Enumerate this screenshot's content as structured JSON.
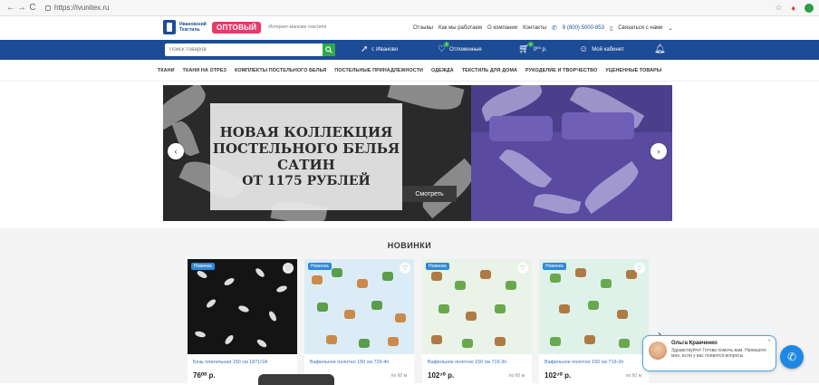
{
  "browser": {
    "url": "https://ivunitex.ru",
    "back": "←",
    "forward": "→",
    "reload": "C"
  },
  "header": {
    "logo_text": "Ивановский Текстиль",
    "badge": "ОПТОВЫЙ",
    "tagline": "Интернет-магазин текстиля",
    "nav": [
      "Отзывы",
      "Как мы работаем",
      "О компании",
      "Контакты"
    ],
    "phone": "8 (800) 5000-853",
    "contact_label": "Связаться с нами",
    "contact_chevron": "⌄"
  },
  "bluebar": {
    "search_placeholder": "Поиск товаров",
    "city": "г. Иваново",
    "deferred": "Отложенные",
    "deferred_count": "0",
    "cart_count": "0",
    "cart_price": "0⁰⁰ р.",
    "account": "Мой кабинет"
  },
  "categories": [
    "ТКАНИ",
    "ТКАНИ НА ОТРЕЗ",
    "КОМПЛЕКТЫ ПОСТЕЛЬНОГО БЕЛЬЯ",
    "ПОСТЕЛЬНЫЕ ПРИНАДЛЕЖНОСТИ",
    "ОДЕЖДА",
    "ТЕКСТИЛЬ ДЛЯ ДОМА",
    "РУКОДЕЛИЕ И ТВОРЧЕСТВО",
    "УЦЕНЕННЫЕ ТОВАРЫ"
  ],
  "banner": {
    "line1": "НОВАЯ КОЛЛЕКЦИЯ",
    "line2": "ПОСТЕЛЬНОГО БЕЛЬЯ",
    "line3": "САТИН",
    "line4": "ОТ 1175 РУБЛЕЙ",
    "button": "Смотреть",
    "prev": "‹",
    "next": "›"
  },
  "novelty": {
    "title": "НОВИНКИ",
    "next": "›",
    "items": [
      {
        "badge": "Новинка",
        "name": "Бязь плательная 150 см 1871/1А",
        "price": "76⁰⁰ р.",
        "unit": ""
      },
      {
        "badge": "Новинка",
        "name": "Вафельное полотно 150 см 719-4п",
        "price": "",
        "unit": "по 60 м"
      },
      {
        "badge": "Новинка",
        "name": "Вафельное полотно 150 см 719-3п",
        "price": "102⁷⁰ р.",
        "unit": "по 60 м"
      },
      {
        "badge": "Новинка",
        "name": "Вафельное полотно 150 см 719-2п",
        "price": "102⁷⁰ р.",
        "unit": "по 60 м"
      }
    ]
  },
  "chat": {
    "name": "Ольга Кравченко",
    "message": "Здравствуйте! Готова помочь вам. Напишите мне, если у вас появятся вопросы.",
    "close": "×"
  },
  "icons": {
    "fav": "♡",
    "phone": "✆"
  }
}
